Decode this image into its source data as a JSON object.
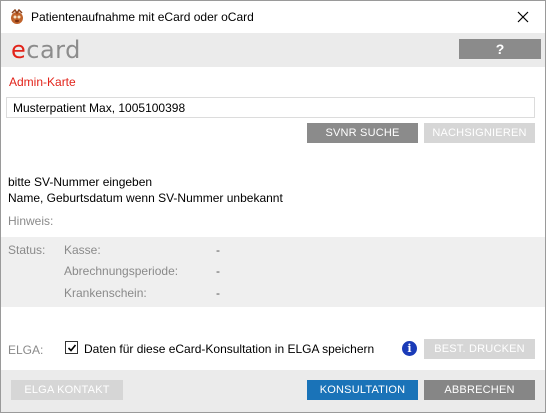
{
  "window": {
    "title": "Patientenaufnahme mit eCard oder oCard",
    "close_icon": "close-icon",
    "app_icon": "app-icon"
  },
  "header": {
    "logo_e": "e",
    "logo_rest": "card",
    "help_label": "?"
  },
  "form": {
    "admin_label": "Admin-Karte",
    "patient_value": "Musterpatient Max, 1005100398",
    "svnr_button": "SVNR SUCHE",
    "nachsignieren_button": "NACHSIGNIEREN",
    "hint_line1": "bitte SV-Nummer eingeben",
    "hint_line2": "Name, Geburtsdatum wenn SV-Nummer unbekannt",
    "hinweis_label": "Hinweis:"
  },
  "status": {
    "label": "Status:",
    "fields": [
      {
        "label": "Kasse:",
        "value": "-"
      },
      {
        "label": "Abrechnungsperiode:",
        "value": "-"
      },
      {
        "label": "Krankenschein:",
        "value": "-"
      }
    ]
  },
  "elga": {
    "label": "ELGA:",
    "checkbox_checked": true,
    "checkbox_text": "Daten für diese eCard-Konsultation in ELGA speichern",
    "info_icon": "i",
    "best_drucken_button": "BEST. DRUCKEN"
  },
  "footer": {
    "elga_kontakt_button": "ELGA KONTAKT",
    "konsultation_button": "KONSULTATION",
    "abbrechen_button": "ABBRECHEN"
  },
  "colors": {
    "brand_red": "#e2231a",
    "primary_blue": "#1a73b8",
    "info_blue": "#1a3bb8",
    "button_gray": "#8b8b8b",
    "disabled_gray": "#d6d6d6"
  }
}
